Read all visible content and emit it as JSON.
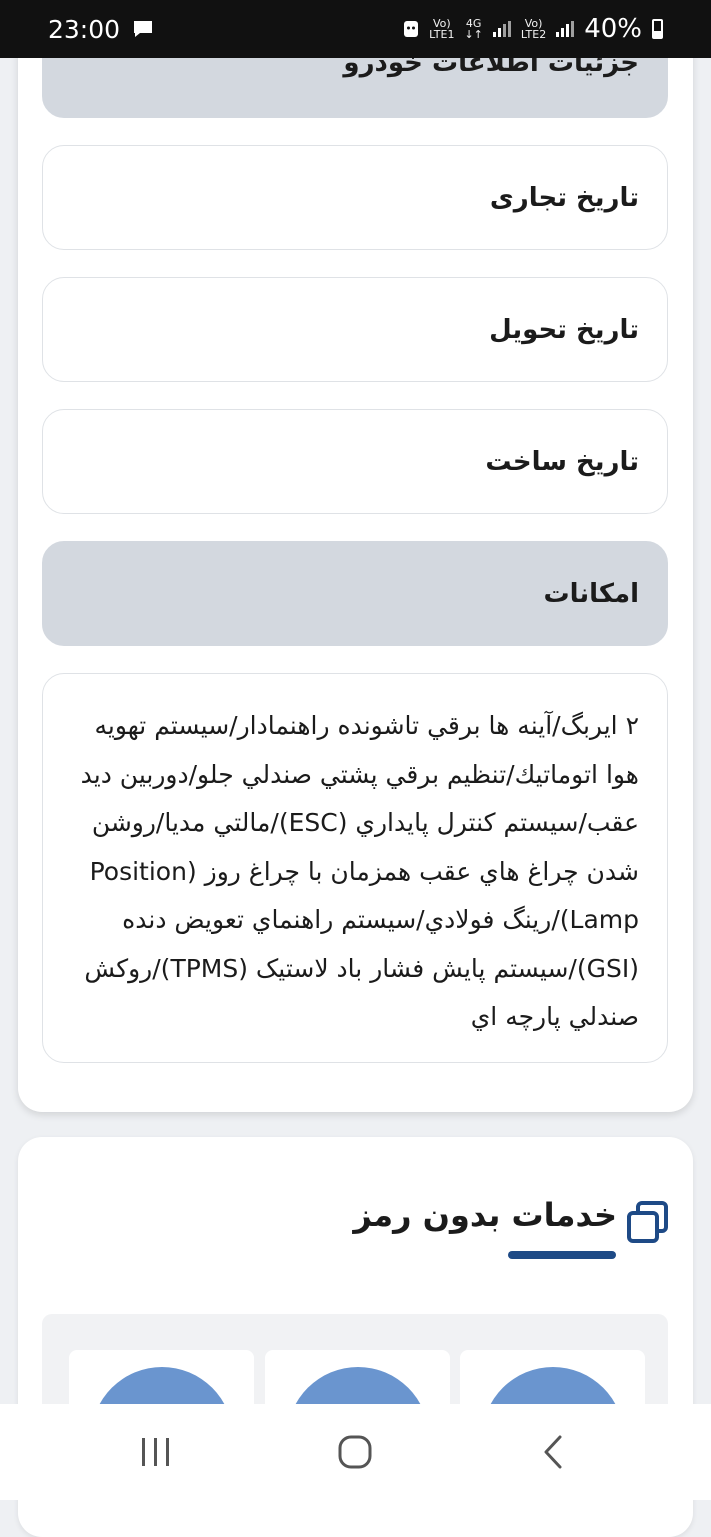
{
  "status_bar": {
    "time": "23:00",
    "message_icon": "chat-icon",
    "sim1_label_top": "Vo)",
    "sim1_label_bottom": "LTE1",
    "network_label_top": "4G",
    "network_label_bottom": "↓↑",
    "sim2_label_top": "Vo)",
    "sim2_label_bottom": "LTE2",
    "battery": "40%"
  },
  "vehicle": {
    "details_header": "جزئیات اطلاعات خودرو",
    "fields": [
      {
        "label": "تاریخ تجاری"
      },
      {
        "label": "تاریخ تحویل"
      },
      {
        "label": "تاریخ ساخت"
      }
    ],
    "features_header": "امکانات",
    "features_text": "۲ ایربگ/آینه ها برقي تاشونده راهنمادار/سیستم تهویه هوا اتوماتیك/تنظیم برقي پشتي صندلي جلو/دوربین دید عقب/سیستم کنترل پایداري (ESC)/مالتي مدیا/روشن شدن چراغ هاي عقب همزمان با چراغ روز (Position Lamp)/رینگ فولادي/سیستم راهنماي تعویض دنده (GSI)/سیستم پایش فشار باد لاستیک (TPMS)/روکش صندلي پارچه اي"
  },
  "services": {
    "title": "خدمات بدون رمز",
    "title_icon": "copy-icon",
    "accent": "#1e4a86"
  },
  "nav": {
    "recent": "recent-apps-icon",
    "home": "home-icon",
    "back": "back-icon"
  }
}
